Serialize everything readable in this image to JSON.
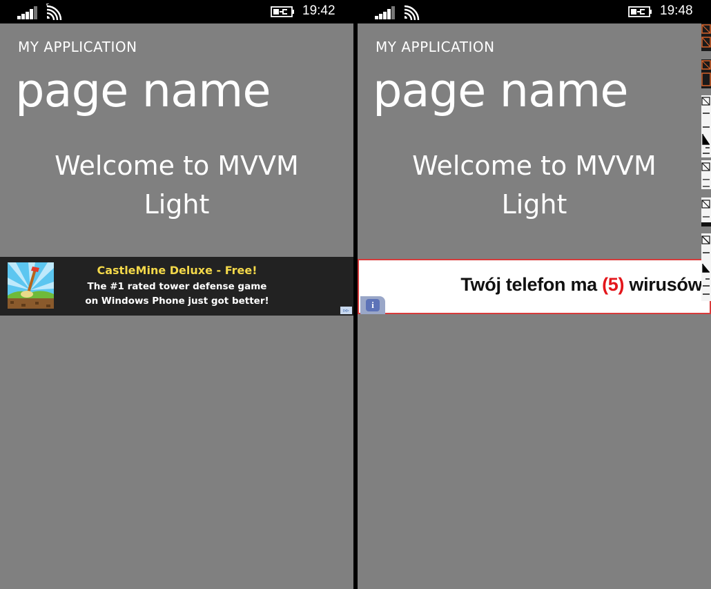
{
  "left_phone": {
    "status": {
      "time": "19:42"
    },
    "app_title": "MY APPLICATION",
    "page_title": "page name",
    "welcome": {
      "line1": "Welcome to MVVM",
      "line2": "Light"
    },
    "ad": {
      "headline": "CastleMine Deluxe - Free!",
      "body_line1": "The #1 rated tower defense game",
      "body_line2": "on Windows Phone just got better!",
      "adchoices_label": "▹▹",
      "icon": "game-thumbnail"
    }
  },
  "right_phone": {
    "status": {
      "time": "19:48"
    },
    "app_title": "MY APPLICATION",
    "page_title": "page name",
    "welcome": {
      "line1": "Welcome to MVVM",
      "line2": "Light"
    },
    "ad": {
      "text_before": "Twój telefon ma ",
      "count": "(5)",
      "text_after": " wirusów!",
      "info_label": "i",
      "count_color": "#e3161b",
      "border_color": "#d83a3a"
    }
  },
  "colors": {
    "page_bg": "#808080",
    "statusbar_bg": "#000000",
    "ad_left_bg": "#222222",
    "ad_headline": "#f3d84a"
  }
}
